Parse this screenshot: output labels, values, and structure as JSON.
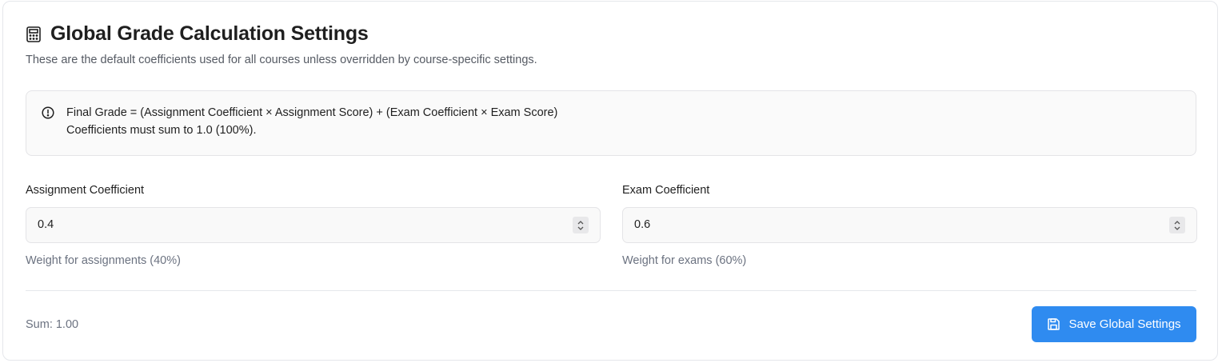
{
  "settings": {
    "title": "Global Grade Calculation Settings",
    "description": "These are the default coefficients used for all courses unless overridden by course-specific settings."
  },
  "info": {
    "formula": "Final Grade = (Assignment Coefficient × Assignment Score) + (Exam Coefficient × Exam Score)",
    "constraint": "Coefficients must sum to 1.0 (100%)."
  },
  "fields": {
    "assignment": {
      "label": "Assignment Coefficient",
      "value": "0.4",
      "help": "Weight for assignments (40%)"
    },
    "exam": {
      "label": "Exam Coefficient",
      "value": "0.6",
      "help": "Weight for exams (60%)"
    }
  },
  "footer": {
    "sum_text": "Sum: 1.00",
    "save_label": "Save Global Settings"
  },
  "icons": {
    "title": "calculator-icon",
    "info": "alert-circle-icon",
    "save": "save-icon",
    "spinner_up": "chevron-up-icon",
    "spinner_down": "chevron-down-icon"
  },
  "colors": {
    "primary": "#2f8bf0",
    "muted_text": "#6b7280",
    "alert_bg": "#fafafa",
    "input_bg": "#f9f9f9"
  }
}
